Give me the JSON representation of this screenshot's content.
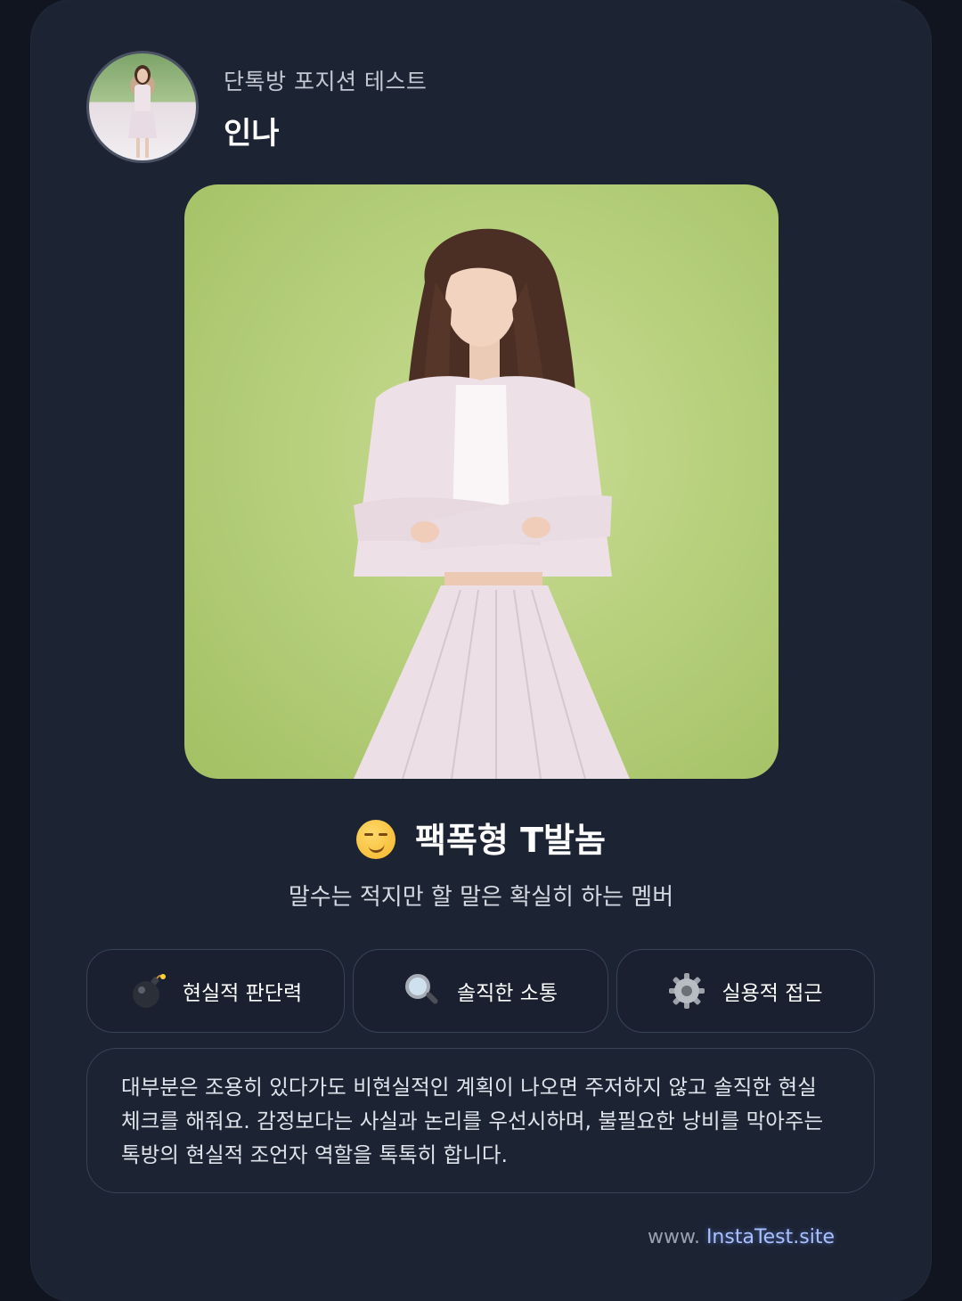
{
  "header": {
    "subtitle": "단톡방 포지션 테스트",
    "name": "인나"
  },
  "result": {
    "emoji_icon": "smirking-face-icon",
    "title": "팩폭형 T발놈",
    "tagline": "말수는 적지만 할 말은 확실히 하는 멤버"
  },
  "traits": [
    {
      "icon": "bomb-icon",
      "label": "현실적 판단력"
    },
    {
      "icon": "magnifying-glass-icon",
      "label": "솔직한 소통"
    },
    {
      "icon": "gear-icon",
      "label": "실용적 접근"
    }
  ],
  "description": "대부분은 조용히 있다가도 비현실적인 계획이 나오면 주저하지 않고 솔직한 현실 체크를 해줘요. 감정보다는 사실과 논리를 우선시하며, 불필요한 낭비를 막아주는 톡방의 현실적 조언자 역할을 톡톡히 합니다.",
  "footer": {
    "prefix": "www.",
    "site": "InstaTest.site"
  },
  "colors": {
    "card_bg": "#1c2333",
    "hero_bg": "#b5cf7b",
    "accent_link": "#a9c1ff"
  }
}
